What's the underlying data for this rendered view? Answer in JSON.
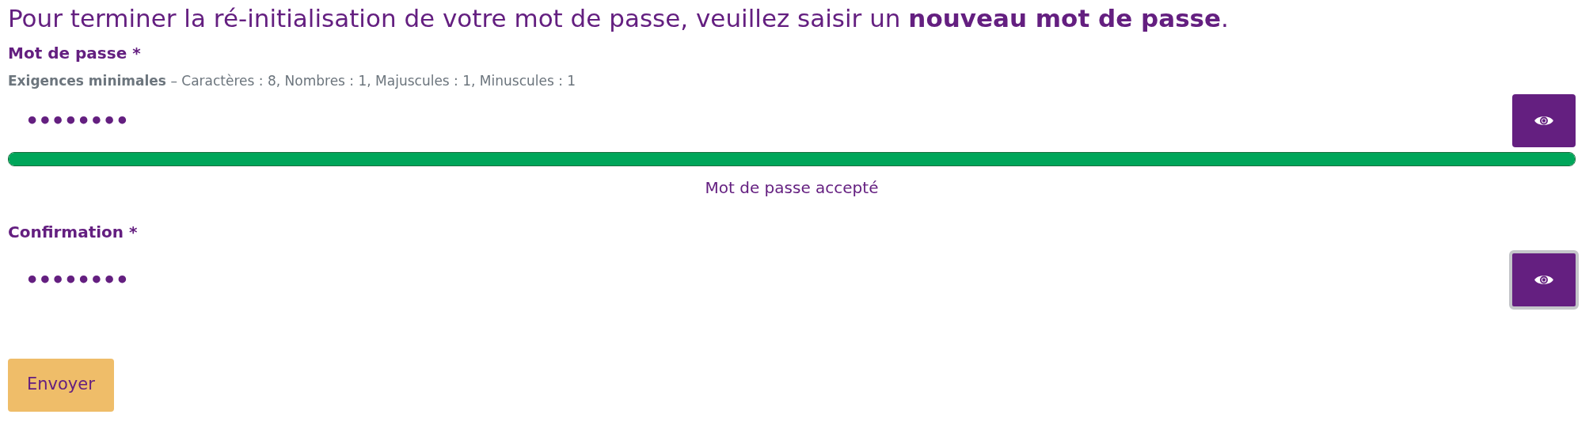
{
  "heading": "Pour terminer la ré-initialisation de votre mot de passe, veuillez saisir un **nouveau mot de passe**.",
  "fields": [
    {
      "label": "Mot de passe *",
      "requirements": "**Exigences minimales** – Caractères : 8, Nombres : 1, Majuscules : 1, Minuscules : 1",
      "value": "••••••••",
      "toggle_focused": false,
      "strength": {
        "level": 1,
        "message": "Mot de passe accepté"
      }
    },
    {
      "label": "Confirmation *",
      "value": "••••••••",
      "toggle_focused": true
    }
  ],
  "submit": "Envoyer"
}
